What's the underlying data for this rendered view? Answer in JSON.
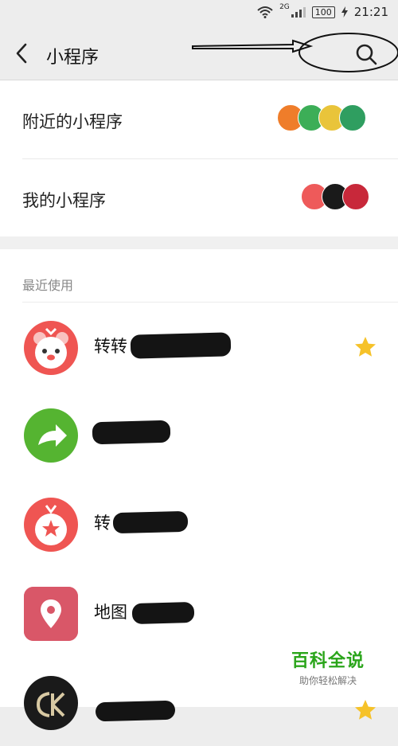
{
  "status_bar": {
    "network": "2G",
    "battery": "100",
    "time": "21:21"
  },
  "header": {
    "title": "小程序",
    "back_icon": "chevron-left-icon",
    "search_icon": "search-icon"
  },
  "entries": [
    {
      "label": "附近的小程序",
      "thumbs": [
        "#ef7d2a",
        "#3cae57",
        "#e9c43a",
        "#2f9e60"
      ]
    },
    {
      "label": "我的小程序",
      "thumbs": [
        "#ee5a5a",
        "#1a1a1a",
        "#c8283a"
      ]
    }
  ],
  "recent": {
    "title": "最近使用",
    "items": [
      {
        "name": "转转",
        "icon_color": "#ef5552",
        "icon": "bear-icon",
        "starred": true
      },
      {
        "name": "",
        "icon_color": "#55b431",
        "icon": "share-arrow-icon",
        "starred": false
      },
      {
        "name": "转",
        "icon_color": "#ef5552",
        "icon": "star-bag-icon",
        "starred": false
      },
      {
        "name": "地图",
        "icon_color": "#d95768",
        "icon": "map-pin-icon",
        "starred": false
      },
      {
        "name": "",
        "icon_color": "#1a1a1a",
        "icon": "ck-logo-icon",
        "starred": true
      }
    ]
  },
  "watermark": {
    "title": "百科全说",
    "subtitle": "助你轻松解决"
  },
  "colors": {
    "star": "#f6c229",
    "background": "#ededed"
  }
}
